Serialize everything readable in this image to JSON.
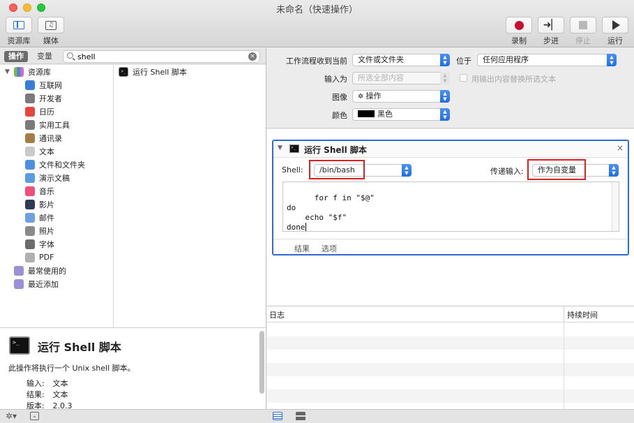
{
  "window": {
    "title": "未命名（快速操作）"
  },
  "toolbar": {
    "library_label": "资源库",
    "media_label": "媒体",
    "record_label": "录制",
    "step_label": "步进",
    "stop_label": "停止",
    "run_label": "运行"
  },
  "left": {
    "tabs": {
      "actions": "操作",
      "variables": "变量"
    },
    "search": {
      "value": "shell"
    },
    "library_root": "资源库",
    "library_items": [
      {
        "label": "互联网",
        "icon": "globe-icon",
        "color": "#3a7bd5"
      },
      {
        "label": "开发者",
        "icon": "tools-icon",
        "color": "#7a7a7a"
      },
      {
        "label": "日历",
        "icon": "calendar-icon",
        "color": "#e8463c"
      },
      {
        "label": "实用工具",
        "icon": "utilities-icon",
        "color": "#7a7a7a"
      },
      {
        "label": "通讯录",
        "icon": "contacts-icon",
        "color": "#a57c43"
      },
      {
        "label": "文本",
        "icon": "text-icon",
        "color": "#c9c9c9"
      },
      {
        "label": "文件和文件夹",
        "icon": "finder-icon",
        "color": "#4c8fe0"
      },
      {
        "label": "演示文稿",
        "icon": "presentation-icon",
        "color": "#5b9be0"
      },
      {
        "label": "音乐",
        "icon": "music-icon",
        "color": "#ef4f7a"
      },
      {
        "label": "影片",
        "icon": "movie-icon",
        "color": "#2f3b56"
      },
      {
        "label": "邮件",
        "icon": "mail-icon",
        "color": "#6fa1e0"
      },
      {
        "label": "照片",
        "icon": "photos-icon",
        "color": "#8a8a8a"
      },
      {
        "label": "字体",
        "icon": "font-icon",
        "color": "#6b6b6b"
      },
      {
        "label": "PDF",
        "icon": "pdf-icon",
        "color": "#b0b0b0"
      }
    ],
    "smart_groups": [
      {
        "label": "最常使用的",
        "icon": "smart-folder-icon"
      },
      {
        "label": "最近添加",
        "icon": "smart-folder-icon"
      }
    ],
    "action_results": [
      {
        "label": "运行 Shell 脚本",
        "icon": "terminal-icon"
      }
    ],
    "detail": {
      "title": "运行 Shell 脚本",
      "description": "此操作将执行一个 Unix shell 脚本。",
      "input_key": "输入:",
      "input_value": "文本",
      "result_key": "结果:",
      "result_value": "文本",
      "version_key": "版本:",
      "version_value": "2.0.3"
    }
  },
  "workflow_settings": {
    "receives_label": "工作流程收到当前",
    "receives_value": "文件或文件夹",
    "in_label": "位于",
    "in_value": "任何应用程序",
    "input_is_label": "输入为",
    "input_is_value": "所选全部内容",
    "replace_label": "用输出内容替换所选文本",
    "image_label": "图像",
    "image_value": "操作",
    "color_label": "颜色",
    "color_value": "黑色"
  },
  "action": {
    "title": "运行 Shell 脚本",
    "shell_label": "Shell:",
    "shell_value": "/bin/bash",
    "pass_input_label": "传递输入:",
    "pass_input_value": "作为自变量",
    "script": "for f in \"$@\"\ndo\n    echo \"$f\"\ndone",
    "tab_results": "结果",
    "tab_options": "选项"
  },
  "log": {
    "col_log": "日志",
    "col_duration": "持续时间"
  }
}
